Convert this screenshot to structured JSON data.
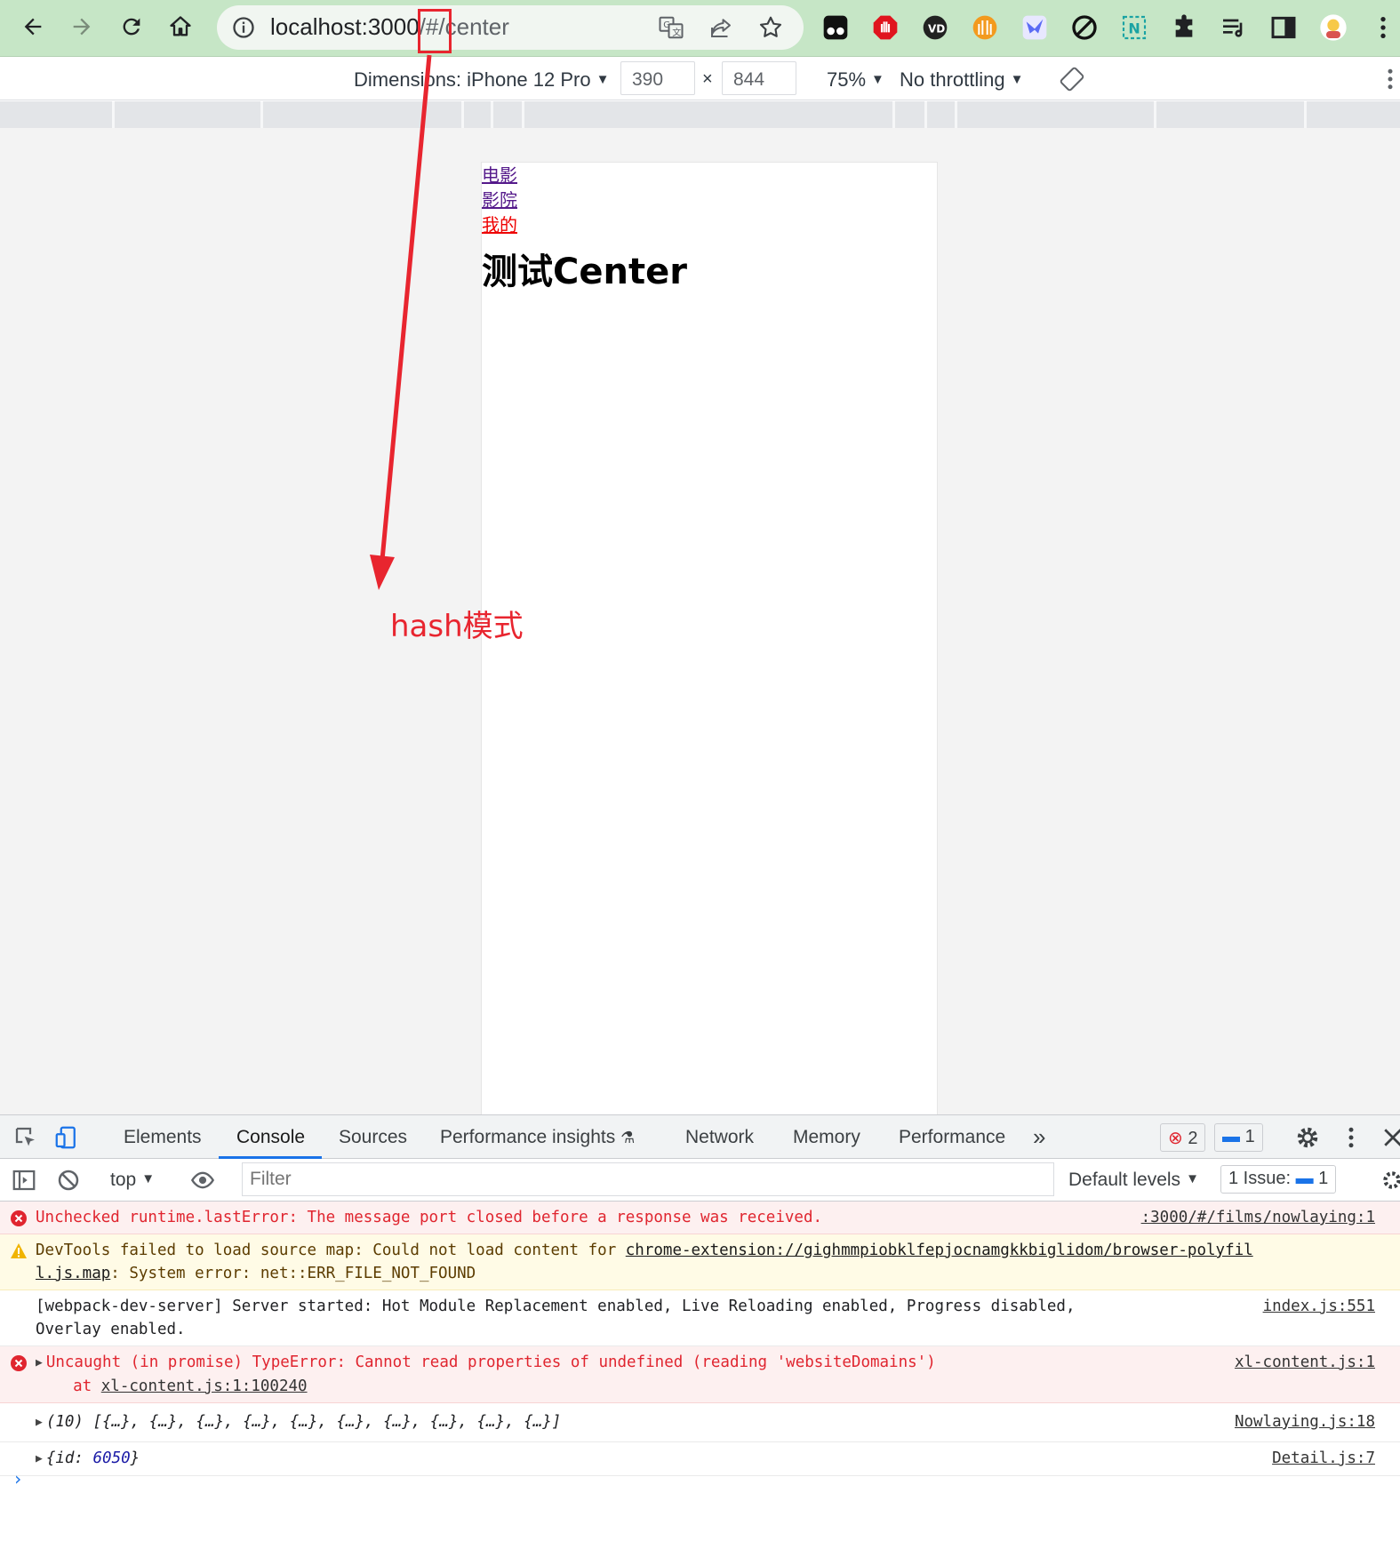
{
  "browser": {
    "url_host": "localhost:3000",
    "url_hash": "/#/",
    "url_path": "center"
  },
  "device_toolbar": {
    "dimensions_label": "Dimensions: iPhone 12 Pro",
    "width": "390",
    "times": "×",
    "height": "844",
    "zoom": "75%",
    "throttling": "No throttling"
  },
  "page": {
    "links": [
      "电影",
      "影院",
      "我的"
    ],
    "heading": "测试Center"
  },
  "annotation": {
    "label": "hash模式",
    "color": "#e8252f"
  },
  "devtools": {
    "tabs": [
      "Elements",
      "Console",
      "Sources",
      "Performance insights",
      "Network",
      "Memory",
      "Performance"
    ],
    "active_tab": "Console",
    "more": "»",
    "error_count": "2",
    "message_count": "1",
    "context": "top",
    "filter_placeholder": "Filter",
    "levels": "Default levels",
    "issues_label": "1 Issue:",
    "issues_count": "1"
  },
  "console": {
    "messages": [
      {
        "level": "error",
        "text": "Unchecked runtime.lastError: The message port closed before a response was received.",
        "source": ":3000/#/films/nowlaying:1"
      },
      {
        "level": "warning",
        "text_prefix": "DevTools failed to load source map: Could not load content for ",
        "link_line1": "chrome-extension://gighmmpiobklfepjocnamgkkbiglidom/browser-polyfil",
        "link_line2": "l.js.map",
        "text_suffix": ": System error: net::ERR_FILE_NOT_FOUND"
      },
      {
        "level": "info",
        "line1": "[webpack-dev-server] Server started: Hot Module Replacement enabled, Live Reloading enabled, Progress disabled,",
        "line2": "Overlay enabled.",
        "source": "index.js:551"
      },
      {
        "level": "error",
        "line1": "Uncaught (in promise) TypeError: Cannot read properties of undefined (reading 'websiteDomains')",
        "line2_prefix": "    at ",
        "line2_link": "xl-content.js:1:100240",
        "source": "xl-content.js:1"
      },
      {
        "level": "log",
        "text": "(10) [{…}, {…}, {…}, {…}, {…}, {…}, {…}, {…}, {…}, {…}]",
        "source": "Nowlaying.js:18"
      },
      {
        "level": "log",
        "key": "{id: ",
        "value": "6050",
        "close": "}",
        "source": "Detail.js:7"
      }
    ],
    "prompt": "›"
  },
  "colors": {
    "toolbar_bg": "#c6e6c6",
    "error_text": "#e0252f",
    "accent": "#1a73e8",
    "visited_link": "#551a8b",
    "active_link": "#ee0000"
  }
}
